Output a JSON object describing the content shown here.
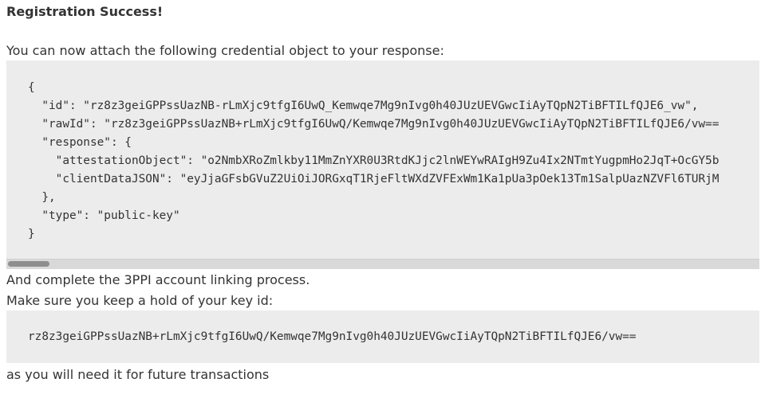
{
  "heading": "Registration Success!",
  "intro_text": "You can now attach the following credential object to your response:",
  "credential_json": {
    "open_brace": "{",
    "id_line": "  \"id\": \"rz8z3geiGPPssUazNB-rLmXjc9tfgI6UwQ_Kemwqe7Mg9nIvg0h40JUzUEVGwcIiAyTQpN2TiBFTILfQJE6_vw\",",
    "rawid_line": "  \"rawId\": \"rz8z3geiGPPssUazNB+rLmXjc9tfgI6UwQ/Kemwqe7Mg9nIvg0h40JUzUEVGwcIiAyTQpN2TiBFTILfQJE6/vw==",
    "response_open": "  \"response\": {",
    "attestation_line": "    \"attestationObject\": \"o2NmbXRoZmlkby11MmZnYXR0U3RtdKJjc2lnWEYwRAIgH9Zu4Ix2NTmtYugpmHo2JqT+OcGY5b",
    "clientdata_line": "    \"clientDataJSON\": \"eyJjaGFsbGVuZ2UiOiJORGxqT1RjeFltWXdZVFExWm1Ka1pUa3pOek13Tm1SalpUazNZVFl6TURjM",
    "response_close": "  },",
    "type_line": "  \"type\": \"public-key\"",
    "close_brace": "}"
  },
  "linking_text": "And complete the 3PPI account linking process.",
  "keep_key_text": "Make sure you keep a hold of your key id:",
  "key_id": "rz8z3geiGPPssUazNB+rLmXjc9tfgI6UwQ/Kemwqe7Mg9nIvg0h40JUzUEVGwcIiAyTQpN2TiBFTILfQJE6/vw==",
  "footer_text": "as you will need it for future transactions"
}
